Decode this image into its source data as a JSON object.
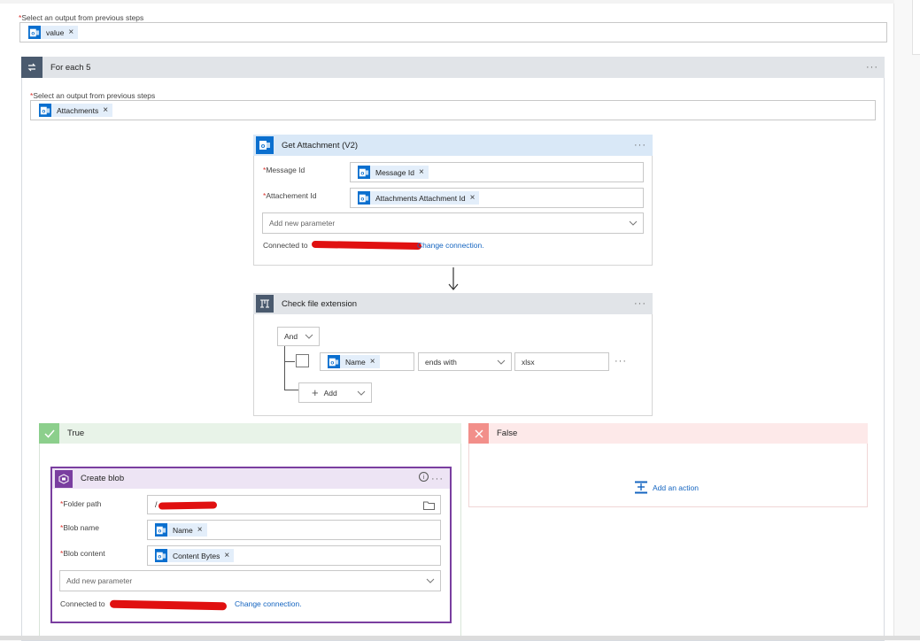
{
  "top_select": {
    "label": "Select an output from previous steps",
    "token": "value"
  },
  "foreach": {
    "title": "For each 5",
    "select_label": "Select an output from previous steps",
    "token": "Attachments"
  },
  "get_attachment": {
    "title": "Get Attachment (V2)",
    "fields": [
      {
        "label": "Message Id",
        "token": "Message Id"
      },
      {
        "label": "Attachement Id",
        "token": "Attachments Attachment Id"
      }
    ],
    "add_param_placeholder": "Add new parameter",
    "connected_label": "Connected to",
    "change_connection": "Change connection."
  },
  "condition": {
    "title": "Check file extension",
    "group_operator": "And",
    "row": {
      "token": "Name",
      "operator": "ends with",
      "value": "xlsx"
    },
    "add_label": "Add"
  },
  "branch_true": {
    "title": "True",
    "color": "#2f9e44"
  },
  "branch_false": {
    "title": "False",
    "color": "#e0605a",
    "add_action": "Add an action"
  },
  "create_blob": {
    "title": "Create blob",
    "folder_label": "Folder path",
    "folder_value": "/",
    "blob_name_label": "Blob name",
    "blob_name_token": "Name",
    "blob_content_label": "Blob content",
    "blob_content_token": "Content Bytes",
    "add_param_placeholder": "Add new parameter",
    "connected_label": "Connected to",
    "change_connection": "Change connection."
  },
  "colors": {
    "outlook_blue": "#0a6fcf",
    "token_bg": "#e3eefa",
    "header_gray": "#e1e4e8",
    "foreach_icon_bg": "#4a5a6e",
    "blob_purple": "#7a3ea0",
    "link_blue": "#1565c0",
    "required_red": "#d8312c"
  }
}
